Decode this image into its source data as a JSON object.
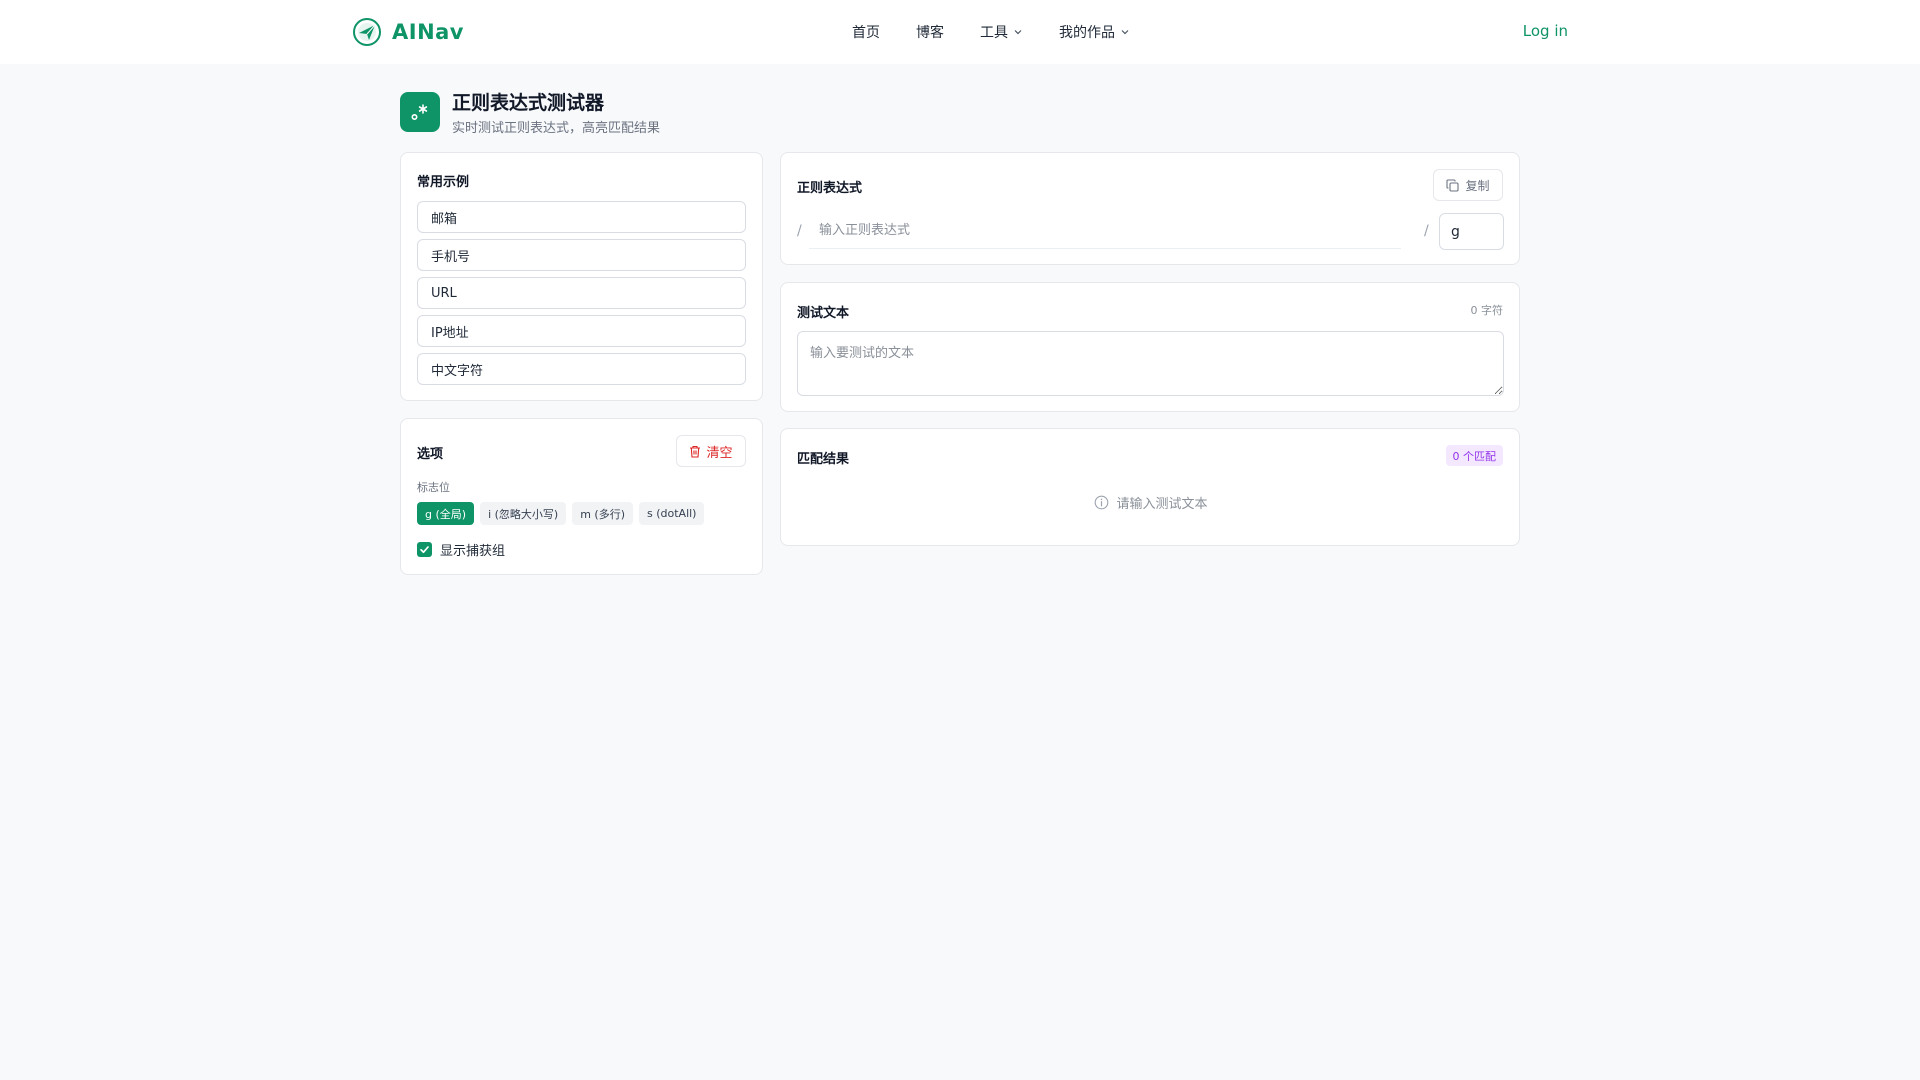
{
  "navbar": {
    "brand": "AINav",
    "menu": [
      {
        "label": "首页"
      },
      {
        "label": "博客"
      },
      {
        "label": "工具",
        "has_dropdown": true
      },
      {
        "label": "我的作品",
        "has_dropdown": true
      }
    ],
    "login": "Log in"
  },
  "page": {
    "title": "正则表达式测试器",
    "subtitle": "实时测试正则表达式，高亮匹配结果"
  },
  "examples": {
    "title": "常用示例",
    "items": [
      "邮箱",
      "手机号",
      "URL",
      "IP地址",
      "中文字符"
    ]
  },
  "options": {
    "title": "选项",
    "clear_label": "清空",
    "flags_label": "标志位",
    "flags": [
      {
        "label": "g (全局)",
        "active": true
      },
      {
        "label": "i (忽略大小写)",
        "active": false
      },
      {
        "label": "m (多行)",
        "active": false
      },
      {
        "label": "s (dotAll)",
        "active": false
      }
    ],
    "show_groups_label": "显示捕获组",
    "show_groups_checked": true
  },
  "regex": {
    "title": "正则表达式",
    "copy_label": "复制",
    "placeholder": "输入正则表达式",
    "value": "",
    "open_slash": "/",
    "close_slash": "/",
    "flags_value": "g"
  },
  "test_text": {
    "title": "测试文本",
    "char_count": "0 字符",
    "placeholder": "输入要测试的文本",
    "value": ""
  },
  "result": {
    "title": "匹配结果",
    "badge": "0 个匹配",
    "empty_message": "请输入测试文本"
  },
  "colors": {
    "accent": "#0f9467",
    "danger": "#dc2626",
    "badge_bg": "#f3e8ff",
    "badge_text": "#9333ea",
    "page_bg": "#f8f9fb"
  }
}
